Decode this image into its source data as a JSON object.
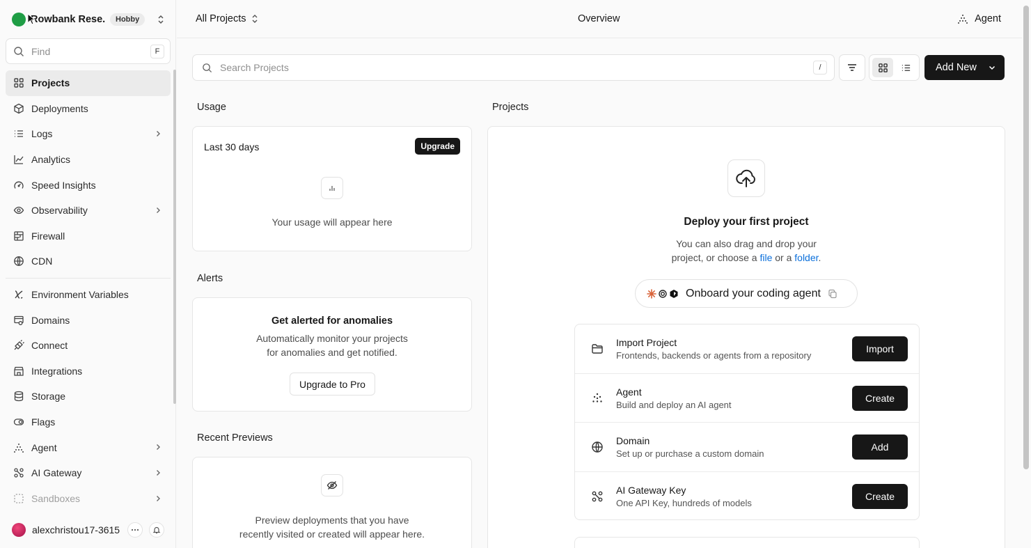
{
  "sidebar": {
    "team_name": "Rowbank Rese...",
    "plan_badge": "Hobby",
    "find_placeholder": "Find",
    "find_shortcut": "F",
    "items": [
      {
        "label": "Projects",
        "icon": "grid-icon",
        "active": true
      },
      {
        "label": "Deployments",
        "icon": "cube-icon"
      },
      {
        "label": "Logs",
        "icon": "list-icon",
        "has_submenu": true
      },
      {
        "label": "Analytics",
        "icon": "line-chart-icon"
      },
      {
        "label": "Speed Insights",
        "icon": "gauge-icon"
      },
      {
        "label": "Observability",
        "icon": "eye-icon",
        "has_submenu": true
      },
      {
        "label": "Firewall",
        "icon": "firewall-icon"
      },
      {
        "label": "CDN",
        "icon": "globe-icon"
      },
      {
        "label": "Environment Variables",
        "icon": "variable-icon"
      },
      {
        "label": "Domains",
        "icon": "domain-icon"
      },
      {
        "label": "Connect",
        "icon": "plug-icon"
      },
      {
        "label": "Integrations",
        "icon": "store-icon"
      },
      {
        "label": "Storage",
        "icon": "database-icon"
      },
      {
        "label": "Flags",
        "icon": "toggle-icon"
      },
      {
        "label": "Agent",
        "icon": "agent-icon",
        "has_submenu": true
      },
      {
        "label": "AI Gateway",
        "icon": "gateway-icon",
        "has_submenu": true
      },
      {
        "label": "Sandboxes",
        "icon": "sandbox-icon",
        "has_submenu": true,
        "muted": true
      }
    ],
    "user_name": "alexchristou17-3615"
  },
  "topbar": {
    "project_switcher": "All Projects",
    "page_title": "Overview",
    "agent_label": "Agent"
  },
  "search": {
    "placeholder": "Search Projects",
    "shortcut": "/"
  },
  "add_new_label": "Add New",
  "usage": {
    "section": "Usage",
    "period": "Last 30 days",
    "upgrade_label": "Upgrade",
    "empty_text": "Your usage will appear here"
  },
  "alerts": {
    "section": "Alerts",
    "title": "Get alerted for anomalies",
    "line1": "Automatically monitor your projects",
    "line2": "for anomalies and get notified.",
    "button": "Upgrade to Pro"
  },
  "previews": {
    "section": "Recent Previews",
    "line1": "Preview deployments that you have",
    "line2": "recently visited or created will appear here."
  },
  "projects": {
    "section": "Projects",
    "title": "Deploy your first project",
    "line1": "You can also drag and drop your",
    "line2_pre": "project, or choose a ",
    "file_link": "file",
    "or_text": " or a ",
    "folder_link": "folder",
    "period": ".",
    "onboard": "Onboard your coding agent",
    "actions": [
      {
        "title": "Import Project",
        "desc": "Frontends, backends or agents from a repository",
        "button": "Import",
        "icon": "folder-icon"
      },
      {
        "title": "Agent",
        "desc": "Build and deploy an AI agent",
        "button": "Create",
        "icon": "agent-icon"
      },
      {
        "title": "Domain",
        "desc": "Set up or purchase a custom domain",
        "button": "Add",
        "icon": "globe-icon"
      },
      {
        "title": "AI Gateway Key",
        "desc": "One API Key, hundreds of models",
        "button": "Create",
        "icon": "gateway-icon"
      }
    ]
  },
  "colors": {
    "accent_dark": "#171717",
    "link": "#0a6fdb",
    "team_avatar": "#1f9d45",
    "user_avatar": "#d11f5e"
  }
}
